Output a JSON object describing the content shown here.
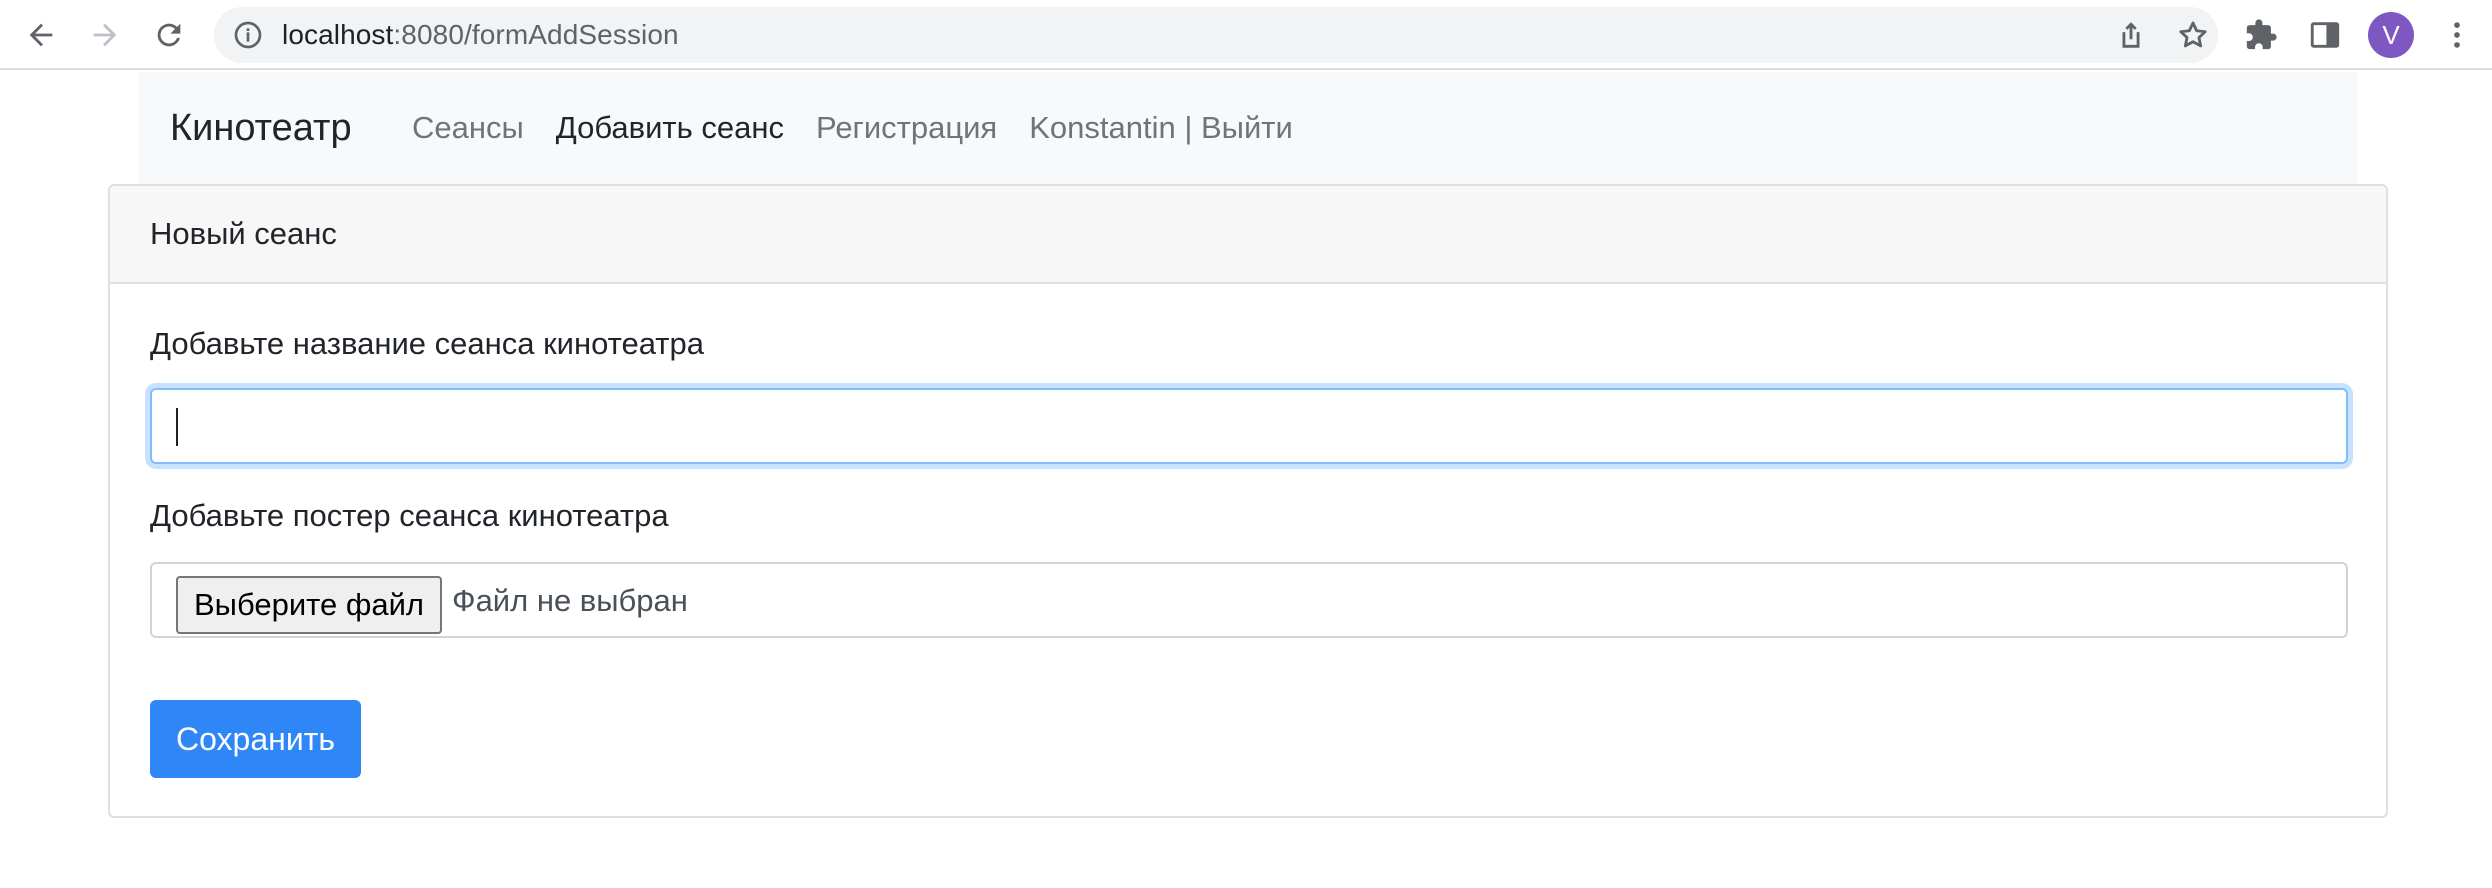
{
  "browser": {
    "url_host": "localhost",
    "url_path": ":8080/formAddSession",
    "avatar_letter": "V",
    "avatar_color": "#7e57c2"
  },
  "navbar": {
    "brand": "Кинотеатр",
    "links": [
      {
        "label": "Сеансы",
        "active": false
      },
      {
        "label": "Добавить сеанс",
        "active": true
      },
      {
        "label": "Регистрация",
        "active": false
      },
      {
        "label": "Konstantin | Выйти",
        "active": false
      }
    ]
  },
  "form": {
    "header": "Новый сеанс",
    "name_label": "Добавьте название сеанса кинотеатра",
    "name_value": "",
    "poster_label": "Добавьте постер сеанса кинотеатра",
    "file_button": "Выберите файл",
    "file_status": "Файл не выбран",
    "submit": "Сохранить"
  },
  "colors": {
    "primary": "#2f86f6",
    "navbar_bg": "#f8f9fa",
    "focus_border": "#80bdff"
  }
}
